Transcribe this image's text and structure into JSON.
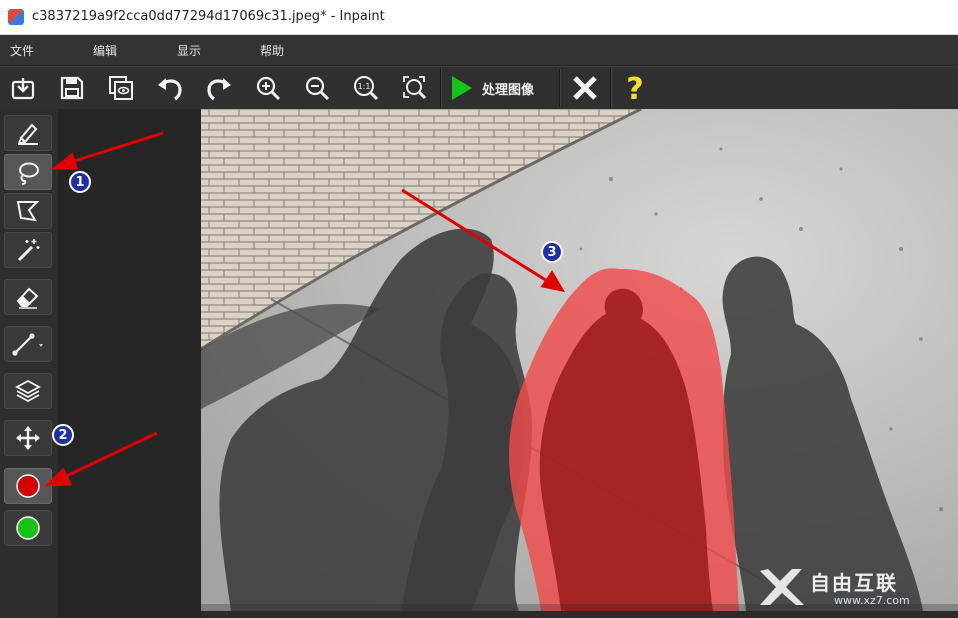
{
  "window": {
    "title": "c3837219a9f2cca0dd77294d17069c31.jpeg* - Inpaint"
  },
  "menu": {
    "items": [
      "文件",
      "编辑",
      "显示",
      "帮助"
    ]
  },
  "toolbar": {
    "process_label": "处理图像",
    "icons": [
      "open-icon",
      "save-icon",
      "save-as-icon",
      "undo-icon",
      "redo-icon",
      "zoom-in-icon",
      "zoom-out-icon",
      "actual-size-icon",
      "fit-icon",
      "process-icon",
      "cancel-icon",
      "help-icon"
    ]
  },
  "tools": {
    "items": [
      "marker-icon",
      "lasso-icon",
      "polygonal-lasso-icon",
      "magic-wand-icon",
      "eraser-icon",
      "line-icon",
      "layers-icon",
      "move-icon"
    ],
    "colors": {
      "red": "#d40000",
      "green": "#18c218"
    }
  },
  "annotations": {
    "badges": [
      "1",
      "2",
      "3"
    ],
    "arrow_color": "#e00000"
  },
  "watermark": {
    "main": "自由互联",
    "sub": "www.xz7.com"
  }
}
